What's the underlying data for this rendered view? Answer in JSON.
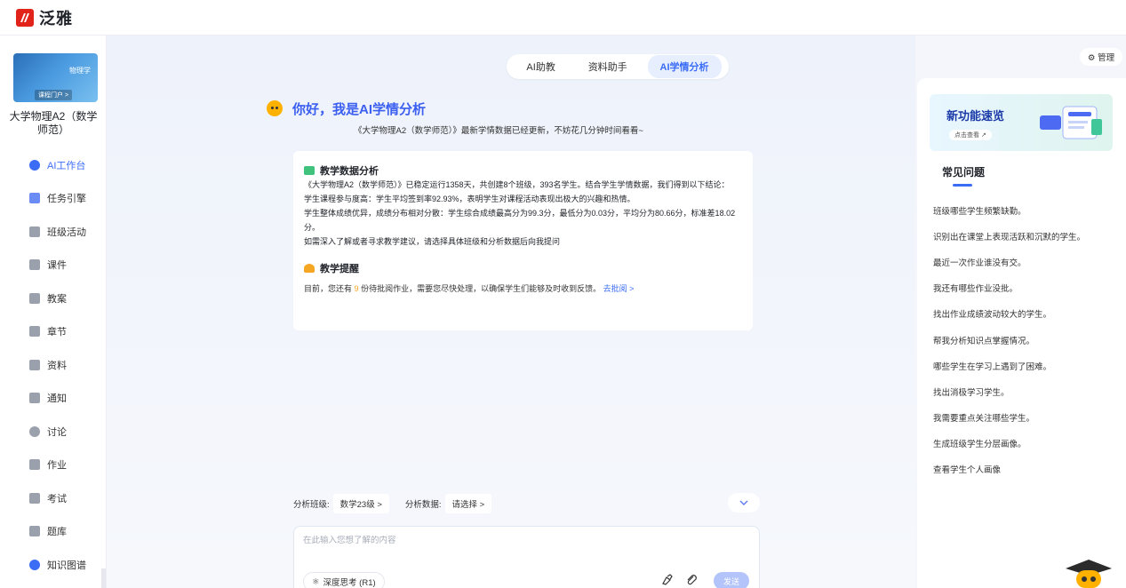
{
  "app": {
    "name": "泛雅"
  },
  "course": {
    "name": "大学物理A2（数学师范）",
    "cover_label": "物理学",
    "portal_label": "课程门户 >"
  },
  "sidebar": {
    "items": [
      {
        "label": "AI工作台",
        "icon": "ai-icon",
        "active": true
      },
      {
        "label": "任务引擎",
        "icon": "task-icon"
      },
      {
        "label": "班级活动",
        "icon": "grid-icon"
      },
      {
        "label": "课件",
        "icon": "file-icon"
      },
      {
        "label": "教案",
        "icon": "doc-icon"
      },
      {
        "label": "章节",
        "icon": "list-icon"
      },
      {
        "label": "资料",
        "icon": "folder-icon"
      },
      {
        "label": "通知",
        "icon": "speaker-icon"
      },
      {
        "label": "讨论",
        "icon": "chat-icon"
      },
      {
        "label": "作业",
        "icon": "edit-icon"
      },
      {
        "label": "考试",
        "icon": "exam-icon"
      },
      {
        "label": "题库",
        "icon": "stack-icon"
      },
      {
        "label": "知识图谱",
        "icon": "graph-icon"
      }
    ]
  },
  "tabs": [
    {
      "label": "AI助教"
    },
    {
      "label": "资料助手"
    },
    {
      "label": "AI学情分析",
      "active": true
    }
  ],
  "greeting": {
    "title": "你好，我是AI学情分析",
    "subtitle": "《大学物理A2（数学师范）》最新学情数据已经更新，不妨花几分钟时间看看~"
  },
  "analysis": {
    "title": "教学数据分析",
    "line1": "《大学物理A2（数学师范）》已稳定运行1358天，共创建8个班级，393名学生。结合学生学情数据，我们得到以下结论：",
    "line2": "学生课程参与度高：学生平均签到率92.93%，表明学生对课程活动表现出极大的兴趣和热情。",
    "line3": "学生整体成绩优异，成绩分布相对分散：学生综合成绩最高分为99.3分，最低分为0.03分，平均分为80.66分，标准差18.02分。",
    "line4": "如需深入了解或者寻求教学建议，请选择具体班级和分析数据后向我提问"
  },
  "reminder": {
    "title": "教学提醒",
    "prefix": "目前，您还有",
    "count": "9",
    "suffix": "份待批阅作业，需要您尽快处理，以确保学生们能够及时收到反馈。",
    "link": "去批阅 >"
  },
  "filters": {
    "class_label": "分析班级:",
    "class_value": "数学23级 >",
    "data_label": "分析数据:",
    "data_value": "请选择 >"
  },
  "composer": {
    "placeholder": "在此输入您想了解的内容",
    "deep_think": "深度思考 (R1)",
    "send": "发送"
  },
  "right": {
    "manage": "⚙ 管理",
    "banner_title": "新功能速览",
    "banner_button": "点击查看 ↗",
    "faq_title": "常见问题",
    "faq": [
      "班级哪些学生频繁缺勤。",
      "识别出在课堂上表现活跃和沉默的学生。",
      "最近一次作业谁没有交。",
      "我还有哪些作业没批。",
      "找出作业成绩波动较大的学生。",
      "帮我分析知识点掌握情况。",
      "哪些学生在学习上遇到了困难。",
      "找出消极学习学生。",
      "我需要重点关注哪些学生。",
      "生成班级学生分层画像。",
      "查看学生个人画像"
    ]
  },
  "colors": {
    "accent": "#3b6cf6",
    "highlight": "#f5a623",
    "brand": "#e2231a"
  }
}
